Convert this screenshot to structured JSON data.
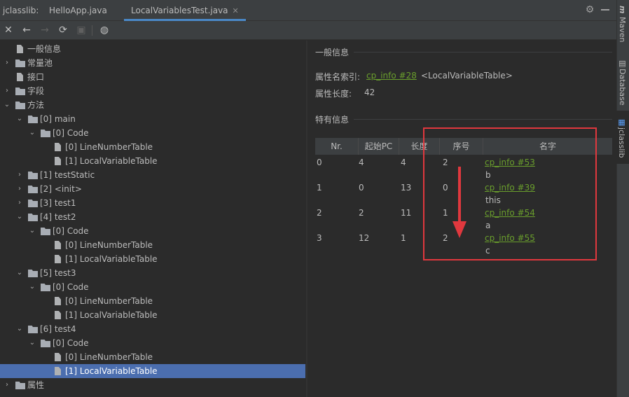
{
  "tabbar": {
    "title": "jclasslib:",
    "tabs": [
      {
        "label": "HelloApp.java"
      },
      {
        "label": "LocalVariablesTest.java",
        "active": true
      }
    ]
  },
  "toolbar": {
    "icons": [
      "close-icon",
      "back-icon",
      "forward-icon",
      "refresh-icon",
      "save-icon",
      "browser-icon"
    ]
  },
  "tree": [
    {
      "label": "一般信息",
      "level": 0,
      "type": "file"
    },
    {
      "label": "常量池",
      "level": 0,
      "type": "folder",
      "arrow": "collapsed"
    },
    {
      "label": "接口",
      "level": 0,
      "type": "file"
    },
    {
      "label": "字段",
      "level": 0,
      "type": "folder",
      "arrow": "collapsed"
    },
    {
      "label": "方法",
      "level": 0,
      "type": "folder",
      "arrow": "expanded"
    },
    {
      "label": "[0] main",
      "level": 1,
      "type": "folder",
      "arrow": "expanded"
    },
    {
      "label": "[0] Code",
      "level": 2,
      "type": "folder",
      "arrow": "expanded"
    },
    {
      "label": "[0] LineNumberTable",
      "level": 3,
      "type": "file"
    },
    {
      "label": "[1] LocalVariableTable",
      "level": 3,
      "type": "file"
    },
    {
      "label": "[1] testStatic",
      "level": 1,
      "type": "folder",
      "arrow": "collapsed"
    },
    {
      "label": "[2] <init>",
      "level": 1,
      "type": "folder",
      "arrow": "collapsed"
    },
    {
      "label": "[3] test1",
      "level": 1,
      "type": "folder",
      "arrow": "collapsed"
    },
    {
      "label": "[4] test2",
      "level": 1,
      "type": "folder",
      "arrow": "expanded"
    },
    {
      "label": "[0] Code",
      "level": 2,
      "type": "folder",
      "arrow": "expanded"
    },
    {
      "label": "[0] LineNumberTable",
      "level": 3,
      "type": "file"
    },
    {
      "label": "[1] LocalVariableTable",
      "level": 3,
      "type": "file"
    },
    {
      "label": "[5] test3",
      "level": 1,
      "type": "folder",
      "arrow": "expanded"
    },
    {
      "label": "[0] Code",
      "level": 2,
      "type": "folder",
      "arrow": "expanded"
    },
    {
      "label": "[0] LineNumberTable",
      "level": 3,
      "type": "file"
    },
    {
      "label": "[1] LocalVariableTable",
      "level": 3,
      "type": "file"
    },
    {
      "label": "[6] test4",
      "level": 1,
      "type": "folder",
      "arrow": "expanded"
    },
    {
      "label": "[0] Code",
      "level": 2,
      "type": "folder",
      "arrow": "expanded"
    },
    {
      "label": "[0] LineNumberTable",
      "level": 3,
      "type": "file"
    },
    {
      "label": "[1] LocalVariableTable",
      "level": 3,
      "type": "file",
      "selected": true
    },
    {
      "label": "属性",
      "level": 0,
      "type": "folder",
      "arrow": "collapsed"
    }
  ],
  "general": {
    "title": "一般信息",
    "name_index_label": "属性名索引:",
    "name_index_link": "cp_info #28",
    "name_index_value": "<LocalVariableTable>",
    "length_label": "属性长度:",
    "length_value": "42"
  },
  "specific": {
    "title": "特有信息",
    "columns": [
      "Nr.",
      "起始PC",
      "长度",
      "序号",
      "名字"
    ],
    "rows": [
      {
        "nr": "0",
        "start_pc": "4",
        "length": "4",
        "index": "2",
        "name_link": "cp_info #53",
        "name": "b"
      },
      {
        "nr": "1",
        "start_pc": "0",
        "length": "13",
        "index": "0",
        "name_link": "cp_info #39",
        "name": "this"
      },
      {
        "nr": "2",
        "start_pc": "2",
        "length": "11",
        "index": "1",
        "name_link": "cp_info #54",
        "name": "a"
      },
      {
        "nr": "3",
        "start_pc": "12",
        "length": "1",
        "index": "2",
        "name_link": "cp_info #55",
        "name": "c"
      }
    ]
  },
  "sidebar": {
    "items": [
      {
        "label": "Maven",
        "icon": "maven-icon"
      },
      {
        "label": "Database",
        "icon": "database-icon"
      },
      {
        "label": "jclasslib",
        "icon": "jclasslib-icon",
        "active": true
      }
    ]
  },
  "colors": {
    "background": "#2b2b2b",
    "panel": "#3c3f41",
    "selection": "#4b6eaf",
    "link_green": "#6a9f2c",
    "value_red": "#d25252",
    "annotation_red": "#e0383e"
  }
}
